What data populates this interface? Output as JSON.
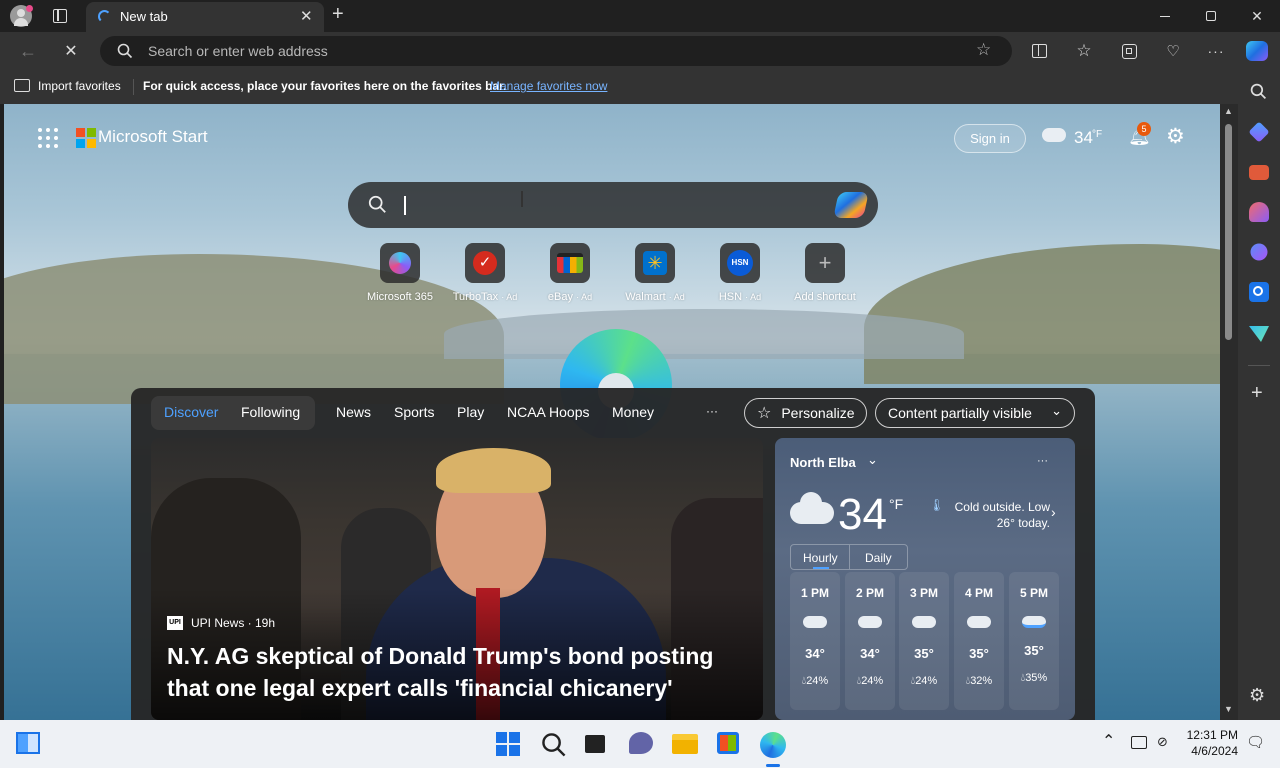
{
  "browser": {
    "tab_title": "New tab",
    "address_placeholder": "Search or enter web address",
    "favorites_bar": {
      "import_label": "Import favorites",
      "hint_text": "For quick access, place your favorites here on the favorites bar.",
      "manage_link": "Manage favorites now"
    }
  },
  "header": {
    "brand": "Microsoft Start",
    "sign_in": "Sign in",
    "weather_temp": "34",
    "weather_unit": "°F",
    "notification_count": "5"
  },
  "shortcuts": [
    {
      "label": "Microsoft 365",
      "ad": ""
    },
    {
      "label": "TurboTax",
      "ad": "· Ad"
    },
    {
      "label": "eBay",
      "ad": "· Ad"
    },
    {
      "label": "Walmart",
      "ad": "· Ad"
    },
    {
      "label": "HSN",
      "ad": "· Ad",
      "icon_text": "HSN"
    },
    {
      "label": "Add shortcut",
      "ad": ""
    }
  ],
  "feed": {
    "tabs": [
      "Discover",
      "Following",
      "News",
      "Sports",
      "Play",
      "NCAA Hoops",
      "Money"
    ],
    "more": "···",
    "personalize": "Personalize",
    "visibility": "Content partially visible"
  },
  "news": {
    "source_icon": "UPI",
    "source": "UPI News · 19h",
    "headline": "N.Y. AG skeptical of Donald Trump's bond posting that one legal expert calls 'financial chicanery'"
  },
  "weather": {
    "location": "North Elba",
    "temp": "34",
    "unit": "°F",
    "summary": "Cold outside. Low 26° today.",
    "tabs": [
      "Hourly",
      "Daily"
    ],
    "more": "···",
    "hours": [
      {
        "time": "1 PM",
        "temp": "34°",
        "precip": "24%"
      },
      {
        "time": "2 PM",
        "temp": "34°",
        "precip": "24%"
      },
      {
        "time": "3 PM",
        "temp": "35°",
        "precip": "24%"
      },
      {
        "time": "4 PM",
        "temp": "35°",
        "precip": "32%"
      },
      {
        "time": "5 PM",
        "temp": "35°",
        "precip": "35%"
      }
    ]
  },
  "taskbar": {
    "time": "12:31 PM",
    "date": "4/6/2024"
  },
  "colors": {
    "accent_blue": "#4ea1ff",
    "link_blue": "#78b4ff",
    "badge_orange": "#e8590c"
  }
}
